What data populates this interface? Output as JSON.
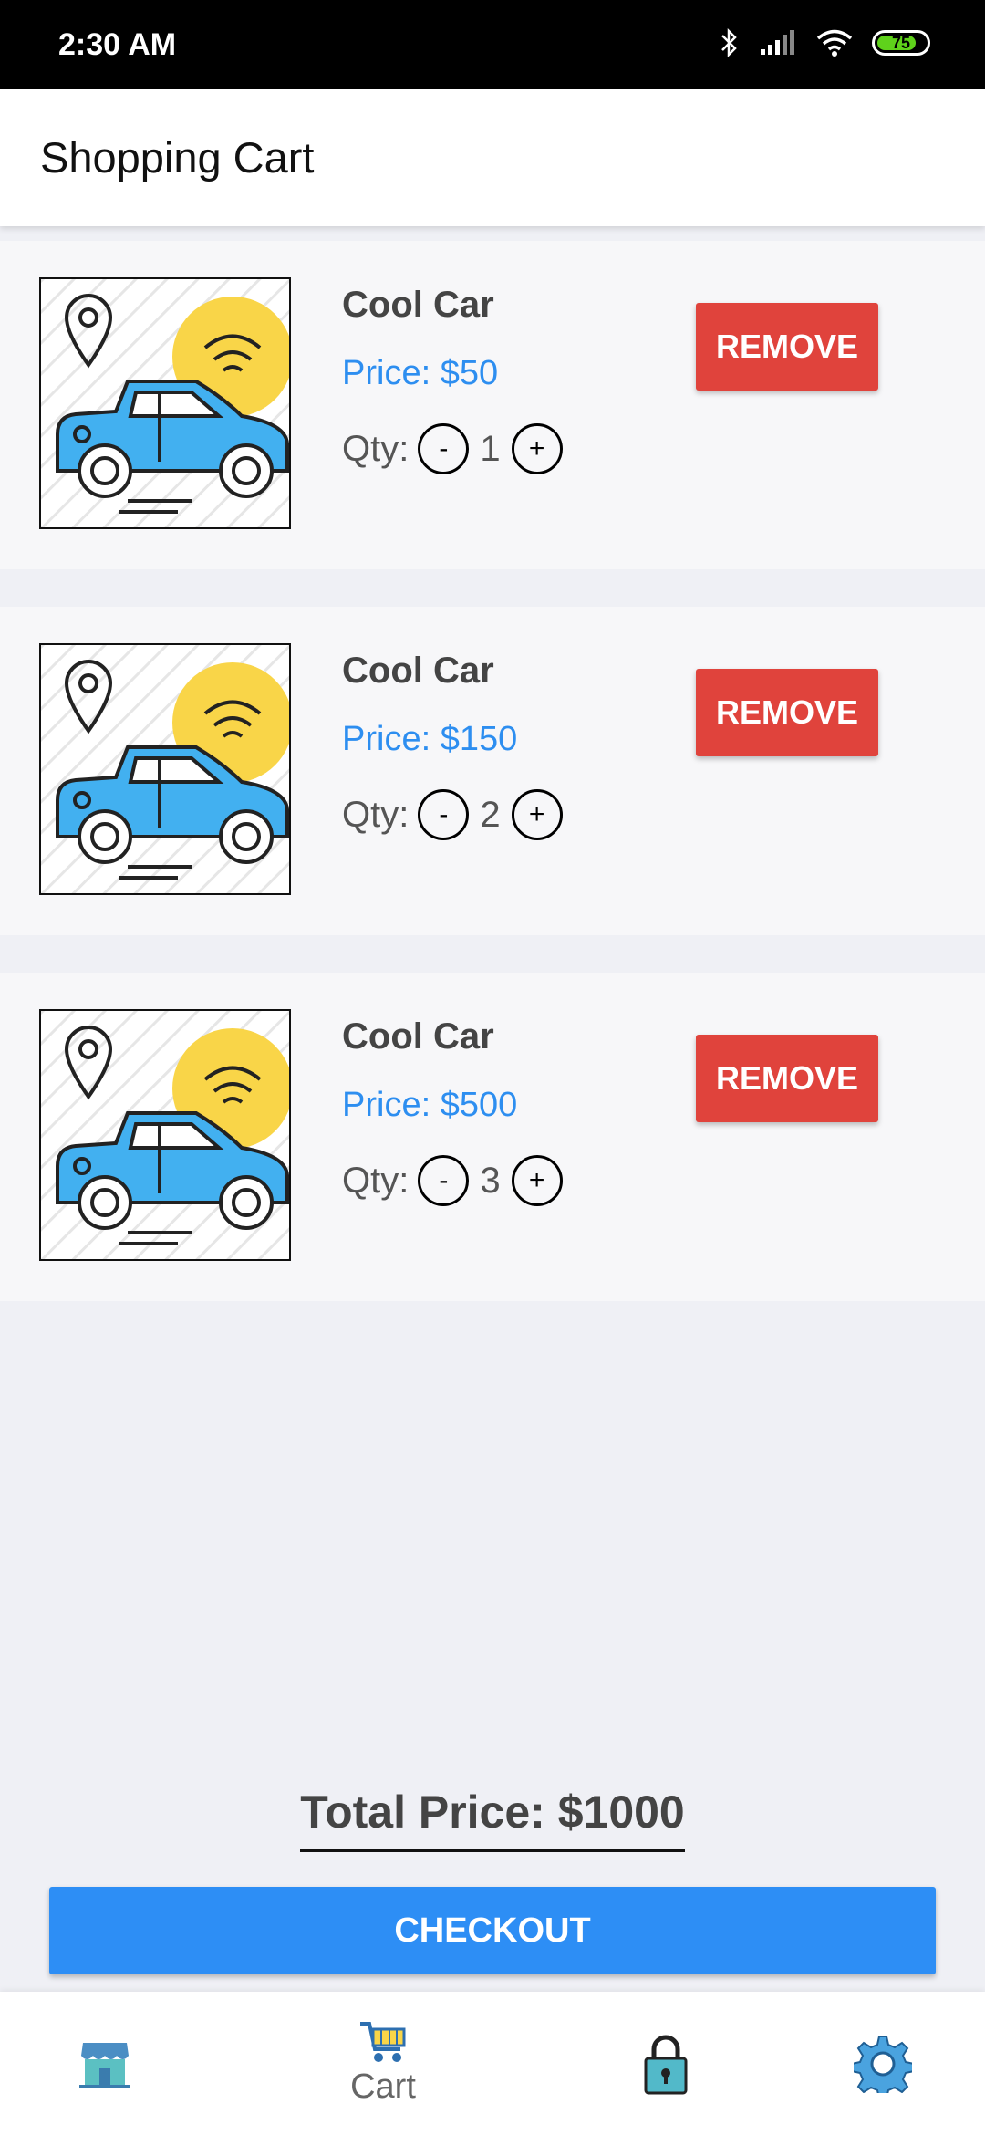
{
  "status_bar": {
    "time": "2:30 AM",
    "battery": "75"
  },
  "header": {
    "title": "Shopping Cart"
  },
  "cart_items": [
    {
      "name": "Cool Car",
      "price": "Price: $50",
      "qty_label": "Qty:",
      "qty": "1",
      "minus": "-",
      "plus": "+",
      "remove_label": "REMOVE"
    },
    {
      "name": "Cool Car",
      "price": "Price: $150",
      "qty_label": "Qty:",
      "qty": "2",
      "minus": "-",
      "plus": "+",
      "remove_label": "REMOVE"
    },
    {
      "name": "Cool Car",
      "price": "Price: $500",
      "qty_label": "Qty:",
      "qty": "3",
      "minus": "-",
      "plus": "+",
      "remove_label": "REMOVE"
    }
  ],
  "total": {
    "text": "Total Price: $1000"
  },
  "checkout": {
    "label": "CHECKOUT"
  },
  "bottom_nav": {
    "items": [
      {
        "icon": "store-icon"
      },
      {
        "icon": "cart-icon",
        "label": "Cart"
      },
      {
        "icon": "lock-icon"
      },
      {
        "icon": "gear-icon"
      }
    ]
  },
  "colors": {
    "accent": "#2d8ef5",
    "remove": "#e0433c",
    "price": "#2d8ef0"
  }
}
